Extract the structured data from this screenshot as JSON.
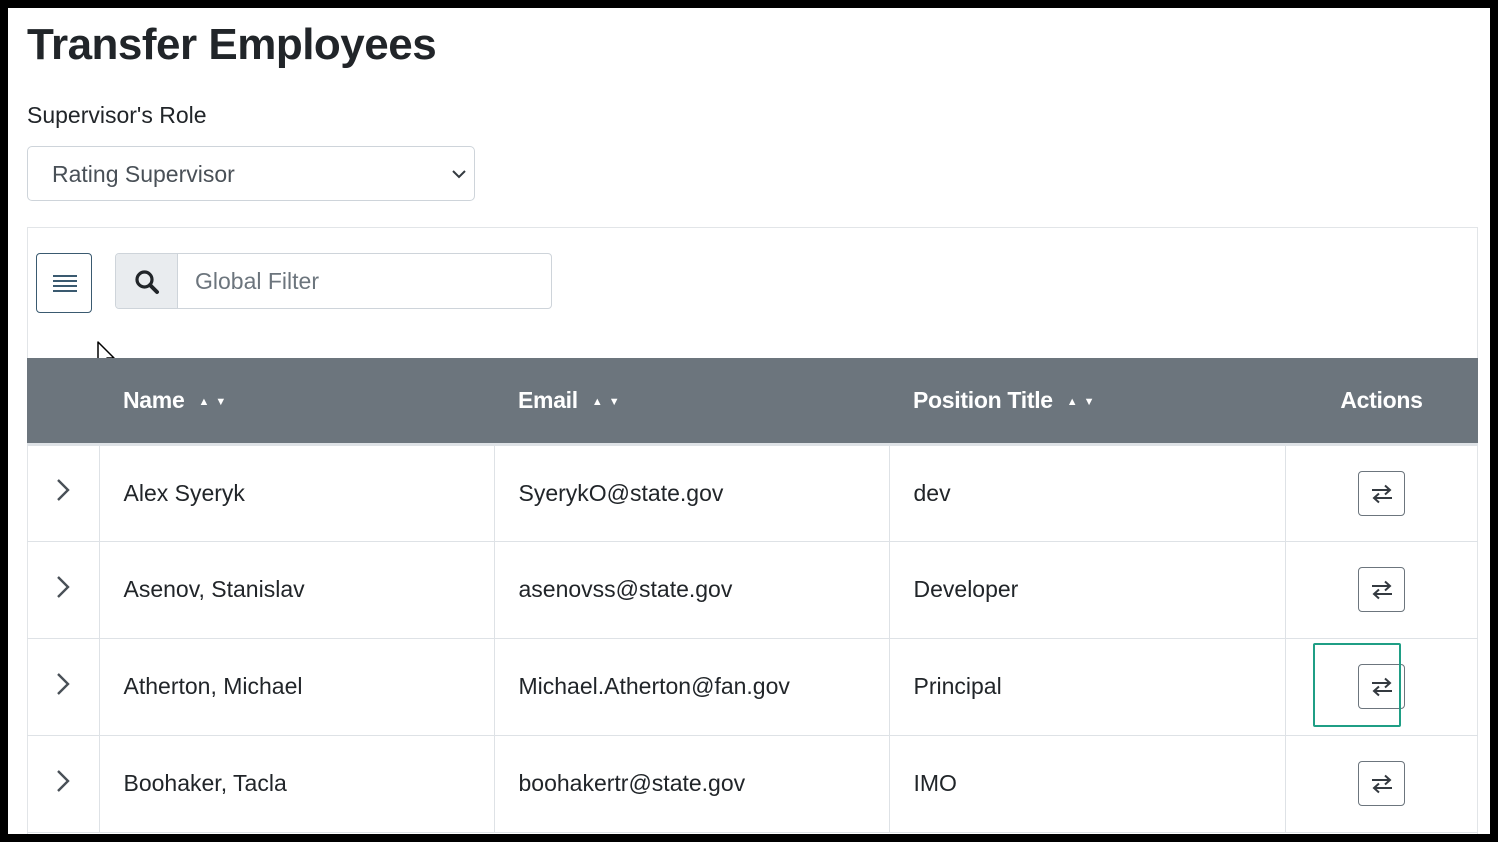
{
  "page": {
    "title": "Transfer Employees"
  },
  "role": {
    "label": "Supervisor's Role",
    "selected": "Rating Supervisor"
  },
  "toolbar": {
    "search_placeholder": "Global Filter"
  },
  "table": {
    "columns": [
      {
        "label": "Name",
        "sortable": true
      },
      {
        "label": "Email",
        "sortable": true
      },
      {
        "label": "Position Title",
        "sortable": true
      },
      {
        "label": "Actions",
        "sortable": false
      }
    ],
    "sort_glyphs": "▲▼",
    "rows": [
      {
        "name": "Alex Syeryk",
        "email": "SyerykO@state.gov",
        "position": "dev"
      },
      {
        "name": "Asenov, Stanislav",
        "email": "asenovss@state.gov",
        "position": "Developer"
      },
      {
        "name": "Atherton, Michael",
        "email": "Michael.Atherton@fan.gov",
        "position": "Principal"
      },
      {
        "name": "Boohaker, Tacla",
        "email": "boohakertr@state.gov",
        "position": "IMO"
      }
    ]
  },
  "colors": {
    "header_bg": "#6c757d",
    "highlight": "#1f9e85",
    "text": "#212529"
  },
  "icons": {
    "menu": "hamburger-icon",
    "search": "search-icon",
    "expand": "chevron-right-icon",
    "transfer": "transfer-arrows-icon",
    "select": "chevron-down-icon"
  }
}
